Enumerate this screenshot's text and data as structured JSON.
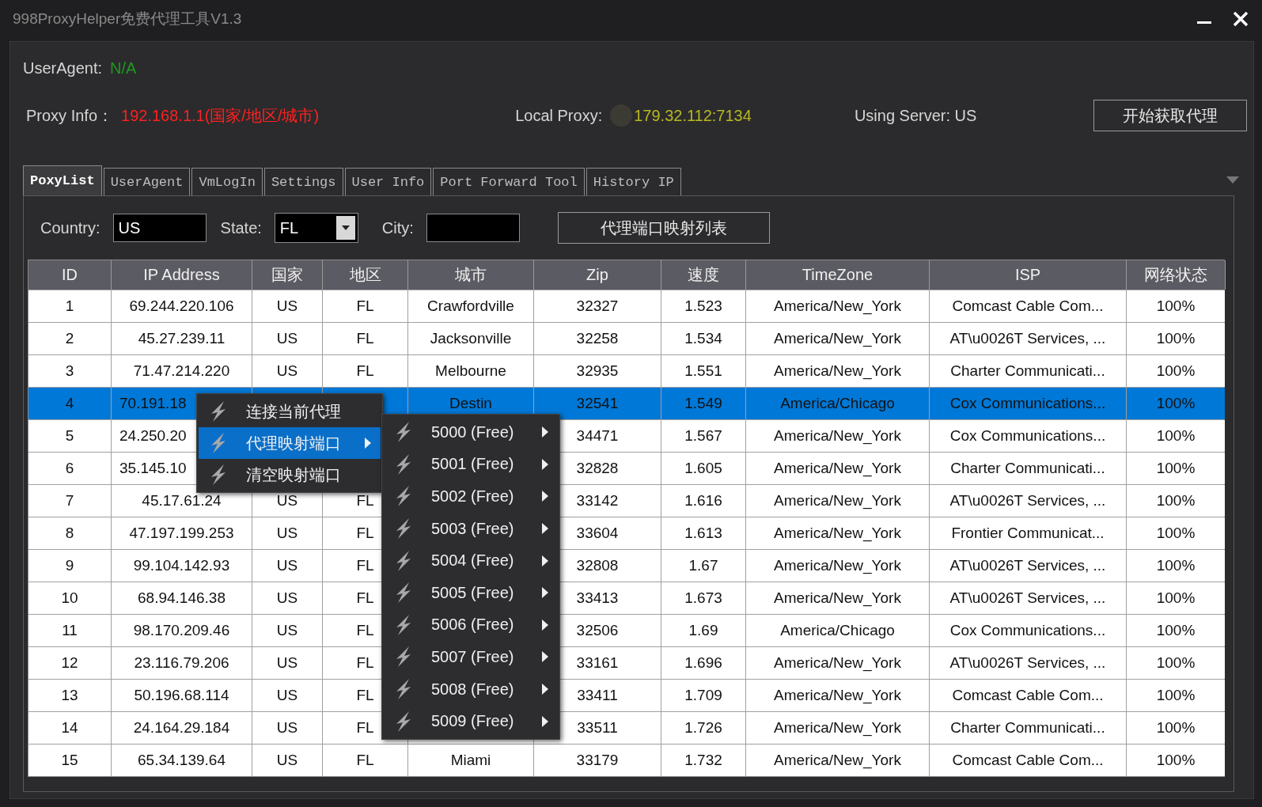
{
  "window": {
    "title": "998ProxyHelper免费代理工具V1.3"
  },
  "user_agent": {
    "label": "UserAgent:",
    "value": "N/A"
  },
  "proxy_info": {
    "label": "Proxy Info：",
    "value": "192.168.1.1(国家/地区/城市)"
  },
  "local_proxy": {
    "label": "Local Proxy:",
    "value": "179.32.112:7134"
  },
  "server": {
    "label": "Using Server: US"
  },
  "start_button": {
    "label": "开始获取代理"
  },
  "tabs": [
    {
      "label": "PoxyList",
      "selected": true
    },
    {
      "label": "UserAgent",
      "selected": false
    },
    {
      "label": "VmLogIn",
      "selected": false
    },
    {
      "label": "Settings",
      "selected": false
    },
    {
      "label": "User Info",
      "selected": false
    },
    {
      "label": "Port Forward Tool",
      "selected": false
    },
    {
      "label": "History IP",
      "selected": false
    }
  ],
  "filters": {
    "country": {
      "label": "Country:",
      "value": "US"
    },
    "state": {
      "label": "State:",
      "value": "FL"
    },
    "city": {
      "label": "City:"
    },
    "map_button": {
      "label": "代理端口映射列表"
    }
  },
  "table": {
    "columns": [
      "ID",
      "IP Address",
      "国家",
      "地区",
      "城市",
      "Zip",
      "速度",
      "TimeZone",
      "ISP",
      "网络状态"
    ],
    "rows": [
      {
        "selected": false,
        "cells": [
          "1",
          "69.244.220.106",
          "US",
          "FL",
          "Crawfordville",
          "32327",
          "1.523",
          "America/New_York",
          "Comcast Cable Com...",
          "100%"
        ]
      },
      {
        "selected": false,
        "cells": [
          "2",
          "45.27.239.11",
          "US",
          "FL",
          "Jacksonville",
          "32258",
          "1.534",
          "America/New_York",
          "AT\\u0026T Services, ...",
          "100%"
        ]
      },
      {
        "selected": false,
        "cells": [
          "3",
          "71.47.214.220",
          "US",
          "FL",
          "Melbourne",
          "32935",
          "1.551",
          "America/New_York",
          "Charter Communicati...",
          "100%"
        ]
      },
      {
        "selected": true,
        "cells": [
          "4",
          "70.191.18",
          null,
          null,
          "Destin",
          "32541",
          "1.549",
          "America/Chicago",
          "Cox Communications...",
          "100%"
        ]
      },
      {
        "selected": false,
        "cells": [
          "5",
          "24.250.20",
          null,
          null,
          null,
          "34471",
          "1.567",
          "America/New_York",
          "Cox Communications...",
          "100%"
        ]
      },
      {
        "selected": false,
        "cells": [
          "6",
          "35.145.10",
          null,
          null,
          null,
          "32828",
          "1.605",
          "America/New_York",
          "Charter Communicati...",
          "100%"
        ]
      },
      {
        "selected": false,
        "cells": [
          "7",
          "45.17.61.24",
          "US",
          "FL",
          null,
          "33142",
          "1.616",
          "America/New_York",
          "AT\\u0026T Services, ...",
          "100%"
        ]
      },
      {
        "selected": false,
        "cells": [
          "8",
          "47.197.199.253",
          "US",
          "FL",
          null,
          "33604",
          "1.613",
          "America/New_York",
          "Frontier Communicat...",
          "100%"
        ]
      },
      {
        "selected": false,
        "cells": [
          "9",
          "99.104.142.93",
          "US",
          "FL",
          null,
          "32808",
          "1.67",
          "America/New_York",
          "AT\\u0026T Services, ...",
          "100%"
        ]
      },
      {
        "selected": false,
        "cells": [
          "10",
          "68.94.146.38",
          "US",
          "FL",
          null,
          "33413",
          "1.673",
          "America/New_York",
          "AT\\u0026T Services, ...",
          "100%"
        ]
      },
      {
        "selected": false,
        "cells": [
          "11",
          "98.170.209.46",
          "US",
          "FL",
          null,
          "32506",
          "1.69",
          "America/Chicago",
          "Cox Communications...",
          "100%"
        ]
      },
      {
        "selected": false,
        "cells": [
          "12",
          "23.116.79.206",
          "US",
          "FL",
          null,
          "33161",
          "1.696",
          "America/New_York",
          "AT\\u0026T Services, ...",
          "100%"
        ]
      },
      {
        "selected": false,
        "cells": [
          "13",
          "50.196.68.114",
          "US",
          "FL",
          null,
          "33411",
          "1.709",
          "America/New_York",
          "Comcast Cable Com...",
          "100%"
        ]
      },
      {
        "selected": false,
        "cells": [
          "14",
          "24.164.29.184",
          "US",
          "FL",
          null,
          "33511",
          "1.726",
          "America/New_York",
          "Charter Communicati...",
          "100%"
        ]
      },
      {
        "selected": false,
        "cells": [
          "15",
          "65.34.139.64",
          "US",
          "FL",
          "Miami",
          "33179",
          "1.732",
          "America/New_York",
          "Comcast Cable Com...",
          "100%"
        ]
      }
    ]
  },
  "context_menu": {
    "items": [
      {
        "label": "连接当前代理",
        "selected": false,
        "has_submenu": false
      },
      {
        "label": "代理映射端口",
        "selected": true,
        "has_submenu": true
      },
      {
        "label": "清空映射端口",
        "selected": false,
        "has_submenu": false
      }
    ],
    "submenu": [
      {
        "label": "5000 (Free)"
      },
      {
        "label": "5001 (Free)"
      },
      {
        "label": "5002 (Free)"
      },
      {
        "label": "5003 (Free)"
      },
      {
        "label": "5004 (Free)"
      },
      {
        "label": "5005 (Free)"
      },
      {
        "label": "5006 (Free)"
      },
      {
        "label": "5007 (Free)"
      },
      {
        "label": "5008 (Free)"
      },
      {
        "label": "5009 (Free)"
      }
    ]
  }
}
